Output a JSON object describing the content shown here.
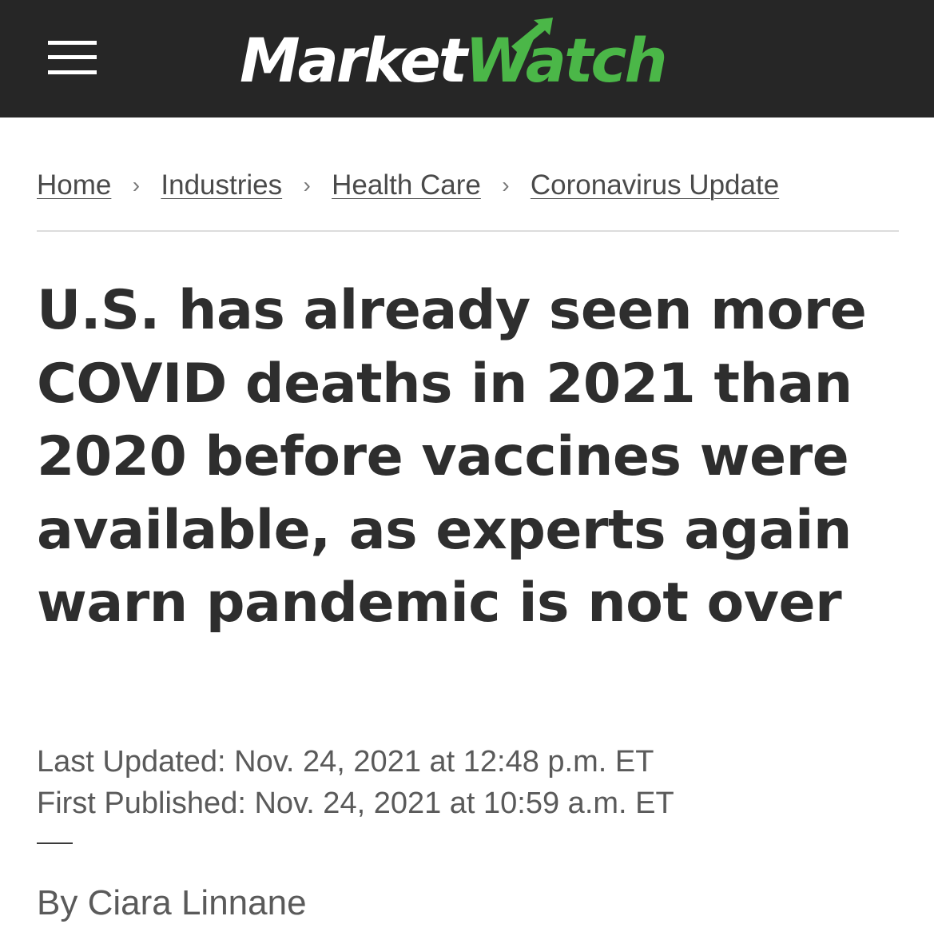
{
  "header": {
    "menu_icon": "hamburger-menu-icon",
    "logo": {
      "part1": "Market",
      "part2": "Watch"
    },
    "colors": {
      "background": "#262626",
      "brand_green": "#4bb748"
    }
  },
  "breadcrumb": {
    "items": [
      {
        "label": "Home"
      },
      {
        "label": "Industries"
      },
      {
        "label": "Health Care"
      },
      {
        "label": "Coronavirus Update"
      }
    ],
    "separator_icon": "chevron-right-icon"
  },
  "article": {
    "headline": "U.S. has already seen more COVID deaths in 2021 than 2020 before vaccines were available, as experts again warn pandemic is not over",
    "last_updated": "Last Updated: Nov. 24, 2021 at 12:48 p.m. ET",
    "first_published": "First Published: Nov. 24, 2021 at 10:59 a.m. ET",
    "byline": "By Ciara Linnane"
  }
}
